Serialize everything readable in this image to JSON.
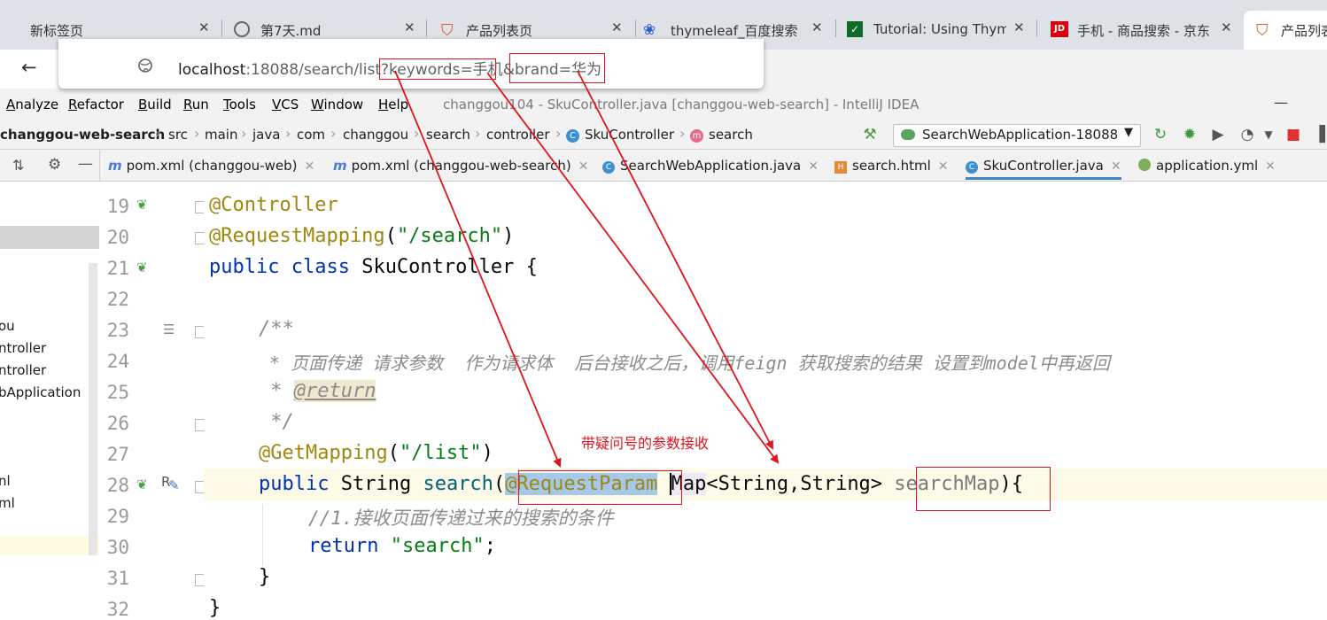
{
  "browser": {
    "tabs": [
      {
        "label": "新标签页",
        "icon": "blank-page-icon"
      },
      {
        "label": "第7天.md",
        "icon": "doc-icon"
      },
      {
        "label": "产品列表页",
        "icon": "bag-icon"
      },
      {
        "label": "thymeleaf_百度搜索",
        "icon": "baidu-paw-icon"
      },
      {
        "label": "Tutorial: Using Thym",
        "icon": "thymeleaf-leaf-icon"
      },
      {
        "label": "手机 - 商品搜索 - 京东",
        "icon": "jd-icon"
      },
      {
        "label": "产品列表",
        "icon": "bag-icon"
      }
    ],
    "url": {
      "host": "localhost",
      "path": ":18088/search/list",
      "param1": "?keywords=手机",
      "amp": "&",
      "param2": "brand=华为"
    }
  },
  "ide": {
    "menu": [
      "Analyze",
      "Refactor",
      "Build",
      "Run",
      "Tools",
      "VCS",
      "Window",
      "Help"
    ],
    "title": "changgou104 - SkuController.java [changgou-web-search] - IntelliJ IDEA",
    "breadcrumb": [
      "changgou-web-search",
      "src",
      "main",
      "java",
      "com",
      "changgou",
      "search",
      "controller",
      "SkuController",
      "search"
    ],
    "run_config": "SearchWebApplication-18088",
    "editor_tabs": [
      {
        "label": "pom.xml (changgou-web)",
        "icon": "maven-m-icon"
      },
      {
        "label": "pom.xml (changgou-web-search)",
        "icon": "maven-m-icon"
      },
      {
        "label": "SearchWebApplication.java",
        "icon": "java-class-icon"
      },
      {
        "label": "search.html",
        "icon": "html-file-icon"
      },
      {
        "label": "SkuController.java",
        "icon": "java-class-icon",
        "active": true
      },
      {
        "label": "application.yml",
        "icon": "yaml-file-icon"
      }
    ],
    "project_items": [
      "ou",
      "ntroller",
      "ntroller",
      "bApplication",
      "nl",
      "ml"
    ],
    "line_numbers": [
      "19",
      "20",
      "21",
      "22",
      "23",
      "24",
      "25",
      "26",
      "27",
      "28",
      "29",
      "30",
      "31",
      "32"
    ],
    "code": {
      "l19_ann": "@Controller",
      "l20_ann": "@RequestMapping",
      "l20_paren_open": "(",
      "l20_str": "\"/search\"",
      "l20_paren_close": ")",
      "l21_kw": "public class",
      "l21_rest": " SkuController {",
      "l23": "/**",
      "l24": " * 页面传递 请求参数  作为请求体  后台接收之后，调用feign 获取搜索的结果 设置到model中再返回",
      "l25_star": " * ",
      "l25_tag": "@return",
      "l26": " */",
      "l27_ann": "@GetMapping",
      "l27_paren_open": "(",
      "l27_str": "\"/list\"",
      "l27_paren_close": ")",
      "l28_kw": "public",
      "l28_type": " String ",
      "l28_method": "search",
      "l28_paren": "(",
      "l28_ann": "@RequestParam",
      "l28_space": " ",
      "l28_map": "Map",
      "l28_generic": "<String,String> ",
      "l28_param": "searchMap",
      "l28_close": "){",
      "l29": "//1.接收页面传递过来的搜索的条件",
      "l30_kw": "return",
      "l30_str": " \"search\"",
      "l30_semi": ";",
      "l31": "}",
      "l32": "}"
    }
  },
  "annotation": {
    "note": "带疑问号的参数接收",
    "color": "#e0141c"
  }
}
